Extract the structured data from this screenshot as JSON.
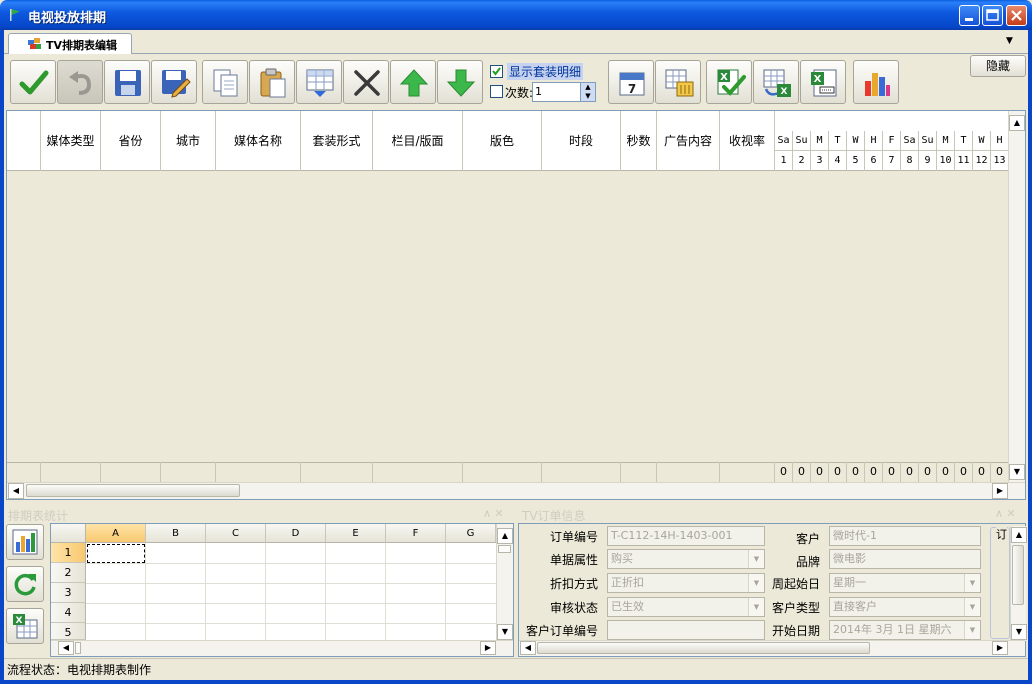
{
  "window": {
    "title": "电视投放排期"
  },
  "tab": {
    "label": "TV排期表编辑"
  },
  "toolbar": {
    "hide_label": "隐藏",
    "show_detail_label": "显示套装明细",
    "show_detail_checked": true,
    "times_label": "次数:",
    "times_checked": false,
    "times_value": "1",
    "buttons": [
      "confirm-icon",
      "undo-icon",
      "save-icon",
      "save-as-icon",
      "copy-icon",
      "paste-icon",
      "insert-row-icon",
      "delete-icon",
      "move-up-icon",
      "move-down-icon",
      "calendar-icon",
      "calendar-table-icon",
      "excel-check-icon",
      "excel-export-icon",
      "excel-word-icon",
      "bar-chart-icon"
    ]
  },
  "grid": {
    "columns": [
      "媒体类型",
      "省份",
      "城市",
      "媒体名称",
      "套装形式",
      "栏目/版面",
      "版色",
      "时段",
      "秒数",
      "广告内容",
      "收视率"
    ],
    "day_weekdays": [
      "Sa",
      "Su",
      "M",
      "T",
      "W",
      "H",
      "F",
      "Sa",
      "Su",
      "M",
      "T",
      "W",
      "H"
    ],
    "day_numbers": [
      "1",
      "2",
      "3",
      "4",
      "5",
      "6",
      "7",
      "8",
      "9",
      "10",
      "11",
      "12",
      "13"
    ],
    "day_totals": [
      "0",
      "0",
      "0",
      "0",
      "0",
      "0",
      "0",
      "0",
      "0",
      "0",
      "0",
      "0",
      "0"
    ]
  },
  "panels": {
    "left_title": "排期表统计",
    "right_title": "TV订单信息",
    "left_ctrl": "∧ ✕",
    "right_ctrl": "∧ ✕"
  },
  "sheet": {
    "columns": [
      "A",
      "B",
      "C",
      "D",
      "E",
      "F",
      "G"
    ],
    "rows": [
      "1",
      "2",
      "3",
      "4",
      "5"
    ]
  },
  "form": {
    "order_no_label": "订单编号",
    "order_no": "T-C112-14H-1403-001",
    "doc_attr_label": "单据属性",
    "doc_attr": "购买",
    "discount_label": "折扣方式",
    "discount": "正折扣",
    "audit_label": "审核状态",
    "audit": "已生效",
    "cust_order_label": "客户订单编号",
    "cust_order": "",
    "customer_label": "客户",
    "customer": "微时代-1",
    "brand_label": "品牌",
    "brand": "微电影",
    "week_start_label": "周起始日",
    "week_start": "星期一",
    "cust_type_label": "客户类型",
    "cust_type": "直接客户",
    "start_date_label": "开始日期",
    "start_date": "2014年  3月  1日  星期六",
    "order_group_label": "订"
  },
  "status": {
    "text": "流程状态：电视排期表制作"
  },
  "colors": {
    "titlebar": "#0a46c8",
    "window_bg": "#ece9d8",
    "accent": "#316ac5"
  }
}
